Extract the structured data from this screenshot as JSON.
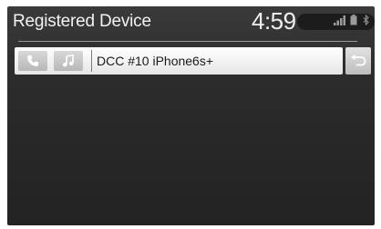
{
  "header": {
    "title": "Registered Device",
    "clock": "4:59",
    "status_icons": [
      "signal-icon",
      "battery-icon",
      "bluetooth-icon"
    ]
  },
  "device_list": {
    "items": [
      {
        "name": "DCC #10 iPhone6s+",
        "action_icons": [
          "phone-icon",
          "music-icon"
        ]
      }
    ]
  },
  "back_button": {
    "icon": "return-arrow-icon"
  },
  "colors": {
    "screen_bg": "#2b2b2b",
    "header_text": "#f2f2f2",
    "row_bg": "#f2f2f2",
    "row_text": "#1a1a1a"
  }
}
